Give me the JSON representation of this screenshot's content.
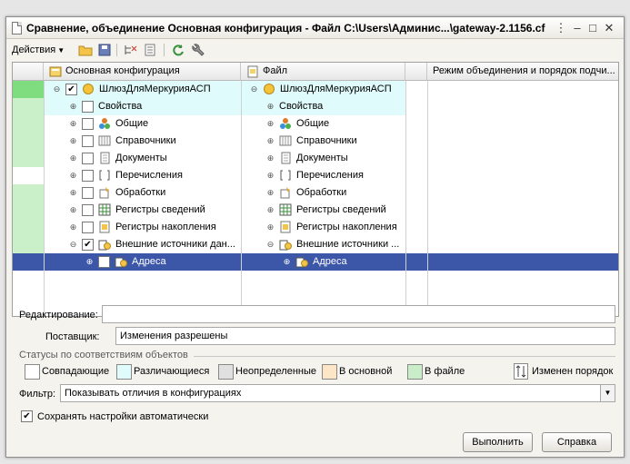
{
  "window": {
    "title": "Сравнение, объединение Основная конфигурация - Файл C:\\Users\\Админис...\\gateway-2.1156.cf"
  },
  "toolbar": {
    "actions_label": "Действия"
  },
  "grid": {
    "columns": [
      "Основная конфигурация",
      "Файл",
      "Режим объединения и порядок подчи..."
    ],
    "rows": [
      {
        "left": "ШлюзДляМеркурияАСП",
        "right": "ШлюзДляМеркурияАСП",
        "icon": "yellow-ball-icon",
        "status_color": "#7fdd7f"
      },
      {
        "left": "Свойства",
        "right": "Свойства",
        "icon": "none",
        "status_color": "#c9f0c9"
      },
      {
        "left": "Общие",
        "right": "Общие",
        "icon": "shapes-icon",
        "status_color": "#c9f0c9"
      },
      {
        "left": "Справочники",
        "right": "Справочники",
        "icon": "catalog-icon",
        "status_color": "#c9f0c9"
      },
      {
        "left": "Документы",
        "right": "Документы",
        "icon": "document-icon",
        "status_color": "#c9f0c9"
      },
      {
        "left": "Перечисления",
        "right": "Перечисления",
        "icon": "enum-icon",
        "status_color": "#ffffff"
      },
      {
        "left": "Обработки",
        "right": "Обработки",
        "icon": "processing-icon",
        "status_color": "#c9f0c9"
      },
      {
        "left": "Регистры сведений",
        "right": "Регистры сведений",
        "icon": "info-register-icon",
        "status_color": "#c9f0c9"
      },
      {
        "left": "Регистры накопления",
        "right": "Регистры накопления",
        "icon": "accum-register-icon",
        "status_color": "#c9f0c9"
      },
      {
        "left": "Внешние источники дан...",
        "right": "Внешние источники ...",
        "icon": "external-source-icon",
        "status_color": "#c9f0c9"
      },
      {
        "left": "Адреса",
        "right": "Адреса",
        "icon": "external-source-icon",
        "status_color": "#3c56a8"
      }
    ]
  },
  "editing": {
    "label": "Редактирование:",
    "value": ""
  },
  "supplier": {
    "label": "Поставщик:",
    "value": "Изменения разрешены"
  },
  "statuses": {
    "title": "Статусы по соответствиям объектов",
    "items": [
      {
        "label": "Совпадающие",
        "color": "#ffffff"
      },
      {
        "label": "Различающиеся",
        "color": "#e0fbfb"
      },
      {
        "label": "Неопределенные",
        "color": "#e0e0e0"
      },
      {
        "label": "В основной",
        "color": "#fde6c6"
      },
      {
        "label": "В файле",
        "color": "#c9ecc9"
      }
    ],
    "changed_order": "Изменен порядок"
  },
  "filter": {
    "label": "Фильтр:",
    "value": "Показывать отличия в конфигурациях"
  },
  "autosave": {
    "label": "Сохранять настройки автоматически",
    "checked": true
  },
  "buttons": {
    "execute": "Выполнить",
    "help": "Справка"
  }
}
